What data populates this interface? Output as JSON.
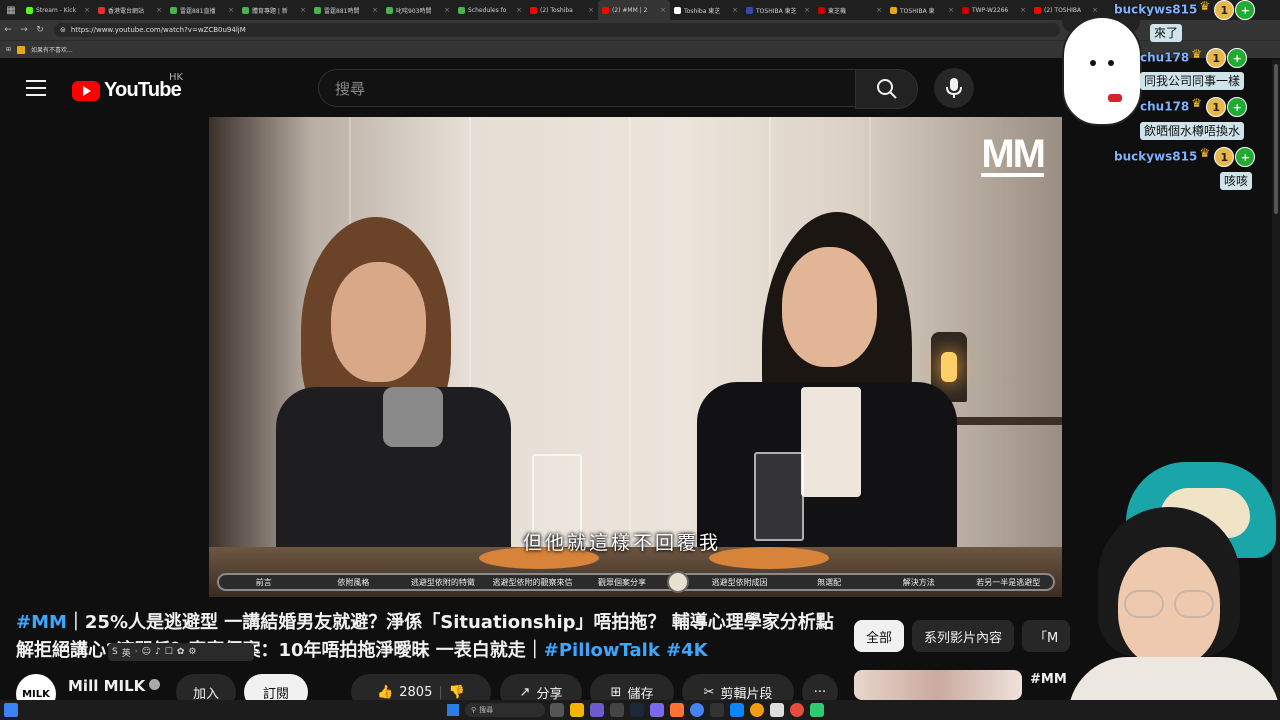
{
  "browser": {
    "tabs": [
      {
        "label": "Stream - Kick",
        "color": "#53fc18"
      },
      {
        "label": "香港電台網站",
        "color": "#e03030"
      },
      {
        "label": "雷霆881直播",
        "color": "#4caf50"
      },
      {
        "label": "體育專題 | 新",
        "color": "#4caf50"
      },
      {
        "label": "雷霆881時間",
        "color": "#4caf50"
      },
      {
        "label": "叱咤903時間",
        "color": "#4caf50"
      },
      {
        "label": "Schedules fo",
        "color": "#4caf50"
      },
      {
        "label": "(2) Toshiba",
        "color": "#ff0000"
      },
      {
        "label": "(2) #MM | 2",
        "color": "#ff0000",
        "active": true
      },
      {
        "label": "Toshiba 東芝",
        "color": "#ffffff"
      },
      {
        "label": "TOSHIBA 東芝",
        "color": "#3949ab"
      },
      {
        "label": "東芝機",
        "color": "#cc0000"
      },
      {
        "label": "TOSHIBA 東",
        "color": "#e6a817"
      },
      {
        "label": "TWP-W2266",
        "color": "#cc0000"
      },
      {
        "label": "(2) TOSHIBA",
        "color": "#ff0000"
      }
    ],
    "url": "https://www.youtube.com/watch?v=wZCB0u94ljM",
    "bookmark": "如果有不喜欢..."
  },
  "youtube": {
    "logo_text": "YouTube",
    "region": "HK",
    "search_placeholder": "搜尋"
  },
  "video": {
    "watermark": "MM",
    "subtitle": "但他就這樣不回覆我",
    "chapters": [
      "前言",
      "依附風格",
      "逃避型依附的特徵",
      "逃避型依附的觀察來信",
      "觀眾個案分享",
      "",
      "逃避型依附成因",
      "無選配",
      "解決方法",
      "若另一半是逃避型"
    ]
  },
  "title": {
    "tag1": "#MM",
    "text": "｜25%人是逃避型 一講結婚男友就避？淨係「Situationship」唔拍拖？ 輔導心理學家分析點解拒絕講心?這關係？真實個案：10年唔拍拖淨曖昧 一表白就走｜",
    "tag2": "#PillowTalk",
    "tag3": "#4K"
  },
  "tray": {
    "items": [
      "S",
      "英",
      "·",
      "☺",
      "♪",
      "☐",
      "✿",
      "⚙"
    ]
  },
  "channel": {
    "avatar_text": "MILK",
    "name": "Mill MILK",
    "join_label": "加入",
    "subscribe_label": "訂閱",
    "likes": "2805",
    "share_label": "分享",
    "save_label": "儲存",
    "clip_label": "剪輯片段",
    "more_label": "···"
  },
  "sidebar": {
    "chips": [
      "全部",
      "系列影片內容",
      "「M"
    ],
    "rec_title": "#MM"
  },
  "chat": {
    "messages": [
      {
        "user": "buckyws815",
        "text": "來了"
      },
      {
        "user": "chu178",
        "text": "同我公司同事一樣"
      },
      {
        "user": "chu178",
        "text": "飲晒個水樽唔換水"
      },
      {
        "user": "buckyws815",
        "text": "咳咳"
      }
    ],
    "badge_number": "1"
  },
  "taskbar": {
    "search_label": "搜尋"
  }
}
